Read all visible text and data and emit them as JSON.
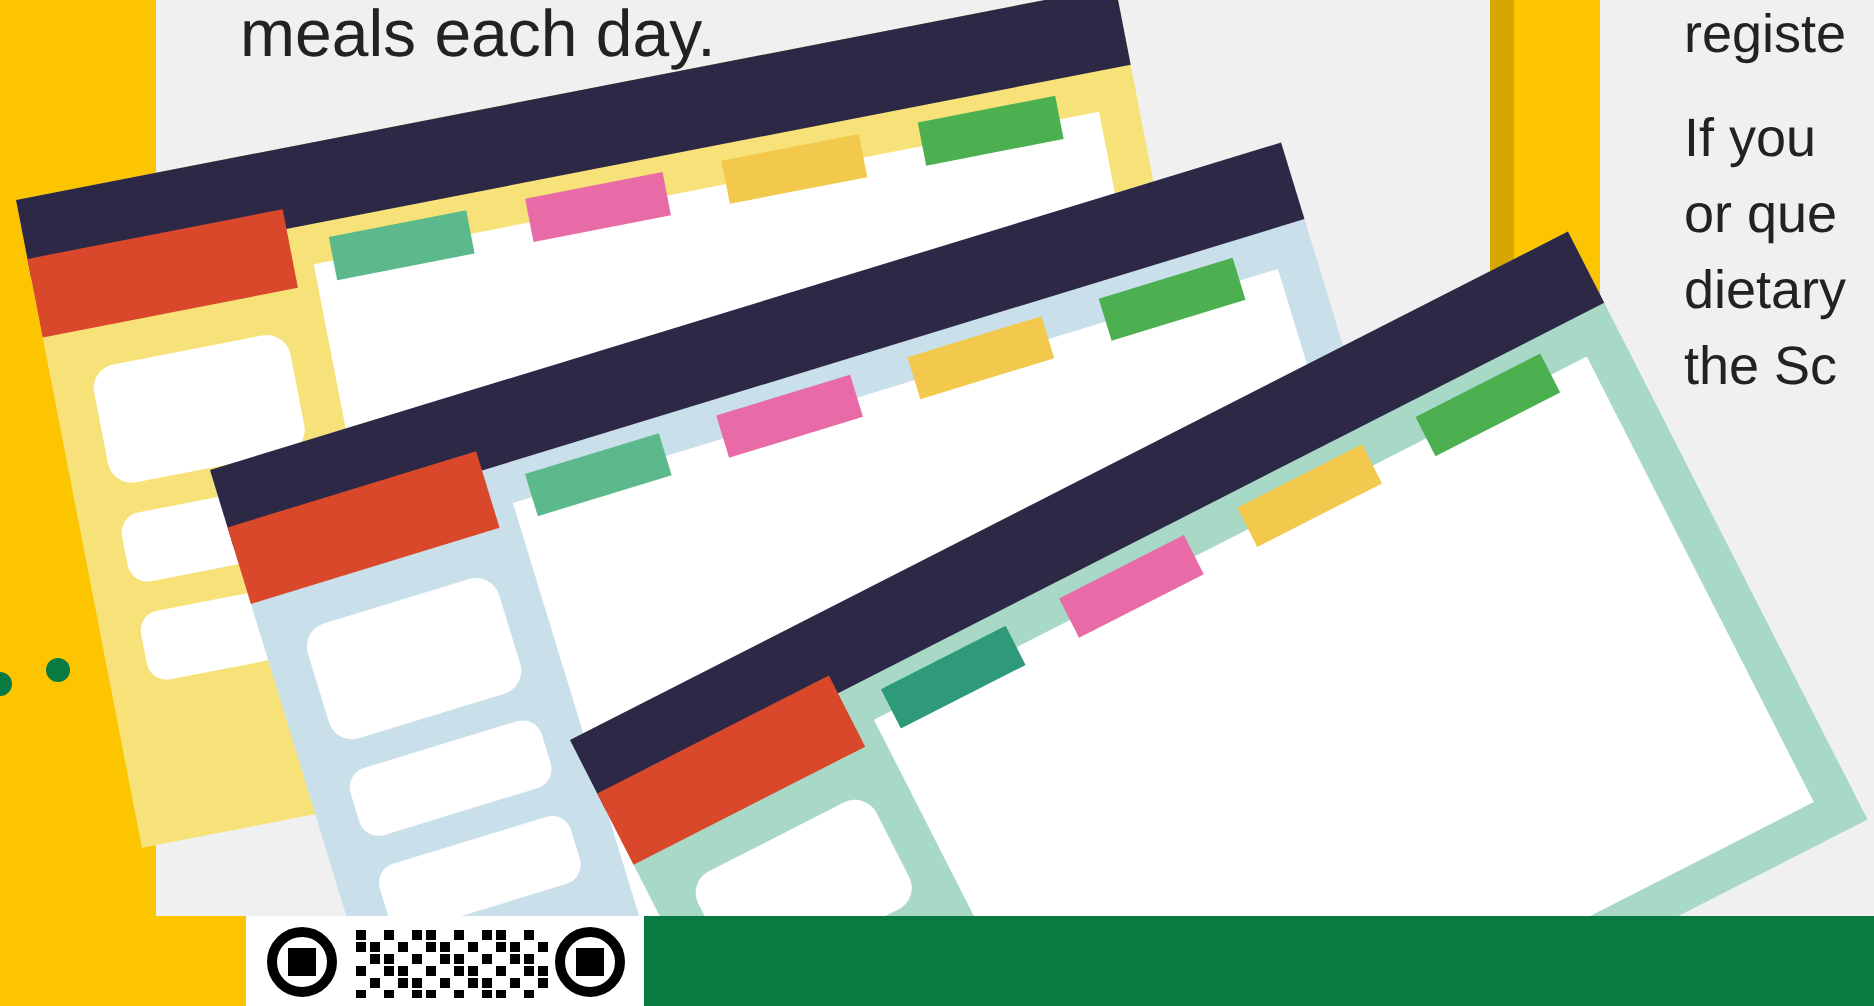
{
  "left_card": {
    "text": "meals each day."
  },
  "right_card": {
    "lines": [
      "registe",
      "If you",
      "or que",
      "dietary",
      "the Sc"
    ]
  }
}
